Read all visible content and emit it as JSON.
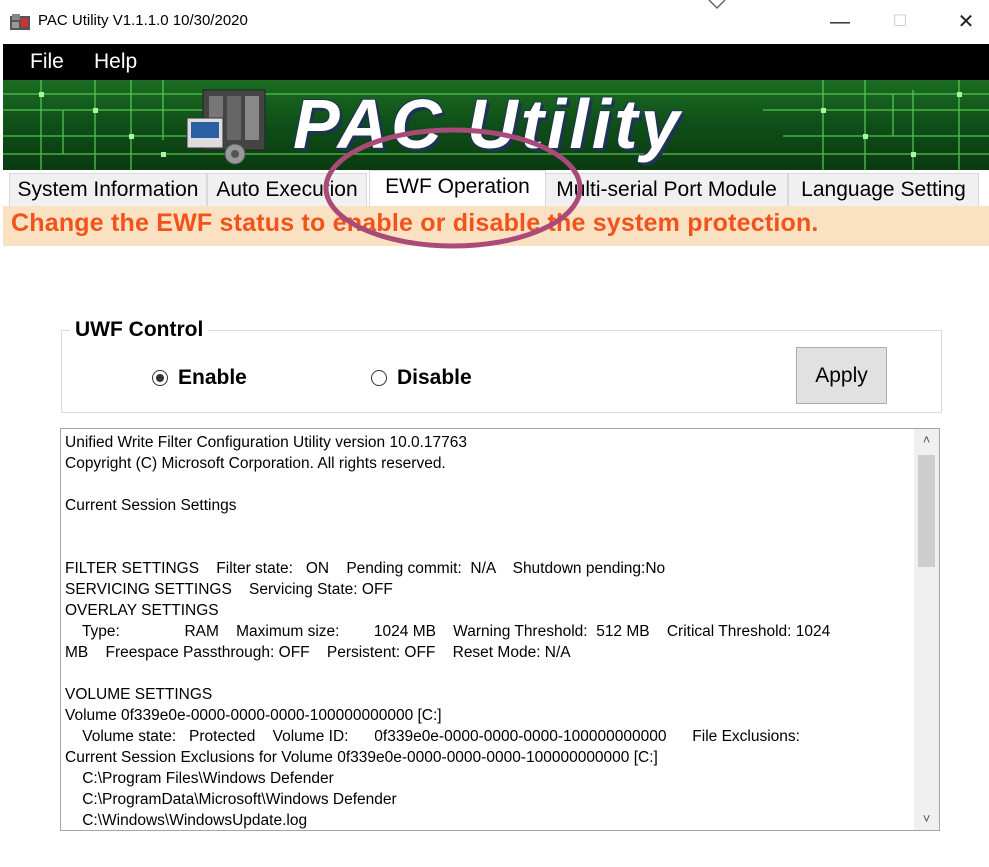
{
  "window": {
    "title": "PAC Utility V1.1.1.0  10/30/2020",
    "minimize_glyph": "—",
    "maximize_glyph": "☐",
    "close_glyph": "✕"
  },
  "menu": {
    "file": "File",
    "help": "Help"
  },
  "banner": {
    "title": "PAC Utility"
  },
  "tabs": [
    {
      "label": "System Information",
      "active": false
    },
    {
      "label": "Auto Execution",
      "active": false
    },
    {
      "label": "EWF Operation",
      "active": true
    },
    {
      "label": "Multi-serial Port Module",
      "active": false
    },
    {
      "label": "Language Setting",
      "active": false
    }
  ],
  "instruction": "Change the EWF status to enable or disable the system protection.",
  "uwf_control": {
    "legend": "UWF Control",
    "enable_label": "Enable",
    "disable_label": "Disable",
    "selected": "Enable",
    "apply_label": "Apply"
  },
  "output": {
    "lines": [
      "Unified Write Filter Configuration Utility version 10.0.17763",
      "Copyright (C) Microsoft Corporation. All rights reserved.",
      "",
      "Current Session Settings",
      "",
      "",
      "FILTER SETTINGS    Filter state:   ON    Pending commit:  N/A    Shutdown pending:No",
      "SERVICING SETTINGS    Servicing State: OFF",
      "OVERLAY SETTINGS",
      "    Type:               RAM    Maximum size:        1024 MB    Warning Threshold:  512 MB    Critical Threshold: 1024",
      "MB    Freespace Passthrough: OFF    Persistent: OFF    Reset Mode: N/A",
      "",
      "VOLUME SETTINGS",
      "Volume 0f339e0e-0000-0000-0000-100000000000 [C:]",
      "    Volume state:   Protected    Volume ID:      0f339e0e-0000-0000-0000-100000000000      File Exclusions:",
      "Current Session Exclusions for Volume 0f339e0e-0000-0000-0000-100000000000 [C:]",
      "    C:\\Program Files\\Windows Defender",
      "    C:\\ProgramData\\Microsoft\\Windows Defender",
      "    C:\\Windows\\WindowsUpdate.log"
    ],
    "scroll_up_glyph": "˄",
    "scroll_down_glyph": "˅"
  },
  "colors": {
    "instruction_text": "#f2531a",
    "instruction_bg": "#fae1c2",
    "menubar_bg": "#000000",
    "highlight_ring": "#a94a78"
  }
}
